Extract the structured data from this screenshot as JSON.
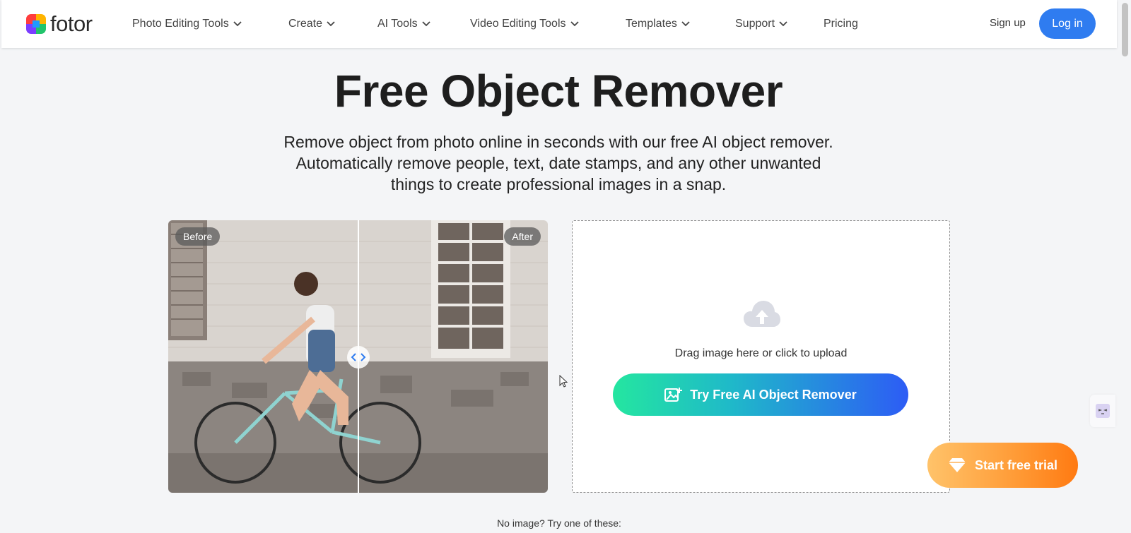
{
  "header": {
    "logo_text": "fotor",
    "nav": [
      {
        "label": "Photo Editing Tools",
        "dropdown": true
      },
      {
        "label": "Create",
        "dropdown": true
      },
      {
        "label": "AI Tools",
        "dropdown": true
      },
      {
        "label": "Video Editing Tools",
        "dropdown": true
      },
      {
        "label": "Templates",
        "dropdown": true
      },
      {
        "label": "Support",
        "dropdown": true
      },
      {
        "label": "Pricing",
        "dropdown": false
      }
    ],
    "signup_label": "Sign up",
    "login_label": "Log in"
  },
  "hero": {
    "title": "Free Object Remover",
    "subtitle_line1": "Remove object from photo online in seconds with our free AI object remover.",
    "subtitle_line2": "Automatically remove people, text, date stamps, and any other unwanted",
    "subtitle_line3": "things to create professional images in a snap."
  },
  "compare": {
    "before_label": "Before",
    "after_label": "After",
    "handle_icon": "left-right-arrows-icon"
  },
  "upload": {
    "icon": "cloud-upload-icon",
    "text": "Drag image here or click to upload",
    "button_label": "Try Free AI Object Remover",
    "button_icon": "image-add-icon"
  },
  "trial": {
    "label": "Start free trial",
    "icon": "diamond-icon"
  },
  "samples": {
    "text": "No image? Try one of these:"
  },
  "colors": {
    "accent_blue": "#2f7cf0",
    "gradient_green": "#24e6a0",
    "gradient_blue": "#2d5cf5",
    "trial_orange": "#ff7a12",
    "page_bg": "#f4f5f7"
  }
}
